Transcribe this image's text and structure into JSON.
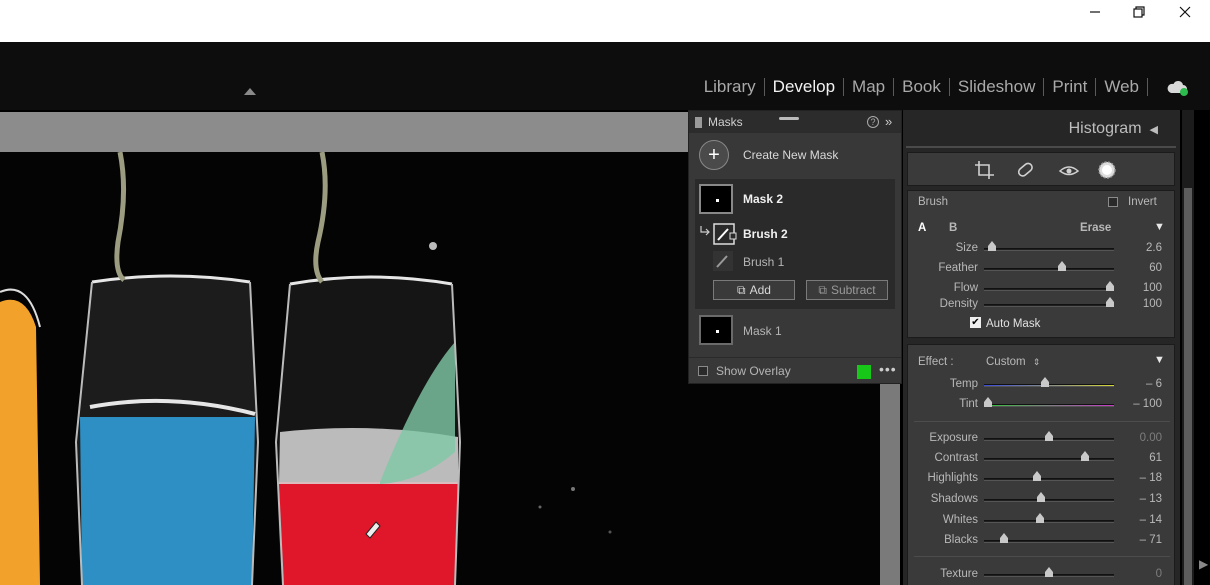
{
  "window": {
    "minimize_icon": "minimize-icon",
    "restore_icon": "restore-icon",
    "close_icon": "close-icon"
  },
  "modules": [
    "Library",
    "Develop",
    "Map",
    "Book",
    "Slideshow",
    "Print",
    "Web"
  ],
  "active_module": "Develop",
  "masks_panel": {
    "title": "Masks",
    "create_label": "Create New Mask",
    "mask2": "Mask 2",
    "brush2": "Brush 2",
    "brush1": "Brush 1",
    "add": "Add",
    "subtract": "Subtract",
    "mask1": "Mask 1",
    "show_overlay": "Show Overlay",
    "overlay_color": "#18c818"
  },
  "right_panel": {
    "histogram": "Histogram",
    "brush": {
      "title": "Brush",
      "invert": "Invert",
      "a": "A",
      "b": "B",
      "erase": "Erase",
      "size": {
        "label": "Size",
        "value": "2.6",
        "pos": 0.06
      },
      "feather": {
        "label": "Feather",
        "value": "60",
        "pos": 0.6
      },
      "flow": {
        "label": "Flow",
        "value": "100",
        "pos": 0.97
      },
      "density": {
        "label": "Density",
        "value": "100",
        "pos": 0.97
      },
      "auto_mask": "Auto Mask"
    },
    "effect": {
      "label": "Effect :",
      "preset": "Custom",
      "temp": {
        "label": "Temp",
        "value": "– 6",
        "pos": 0.47
      },
      "tint": {
        "label": "Tint",
        "value": "– 100",
        "pos": 0.03
      },
      "exposure": {
        "label": "Exposure",
        "value": "0.00",
        "pos": 0.5
      },
      "contrast": {
        "label": "Contrast",
        "value": "61",
        "pos": 0.78
      },
      "highlights": {
        "label": "Highlights",
        "value": "– 18",
        "pos": 0.41
      },
      "shadows": {
        "label": "Shadows",
        "value": "– 13",
        "pos": 0.44
      },
      "whites": {
        "label": "Whites",
        "value": "– 14",
        "pos": 0.43
      },
      "blacks": {
        "label": "Blacks",
        "value": "– 71",
        "pos": 0.15
      },
      "texture": {
        "label": "Texture",
        "value": "0",
        "pos": 0.5
      }
    }
  }
}
